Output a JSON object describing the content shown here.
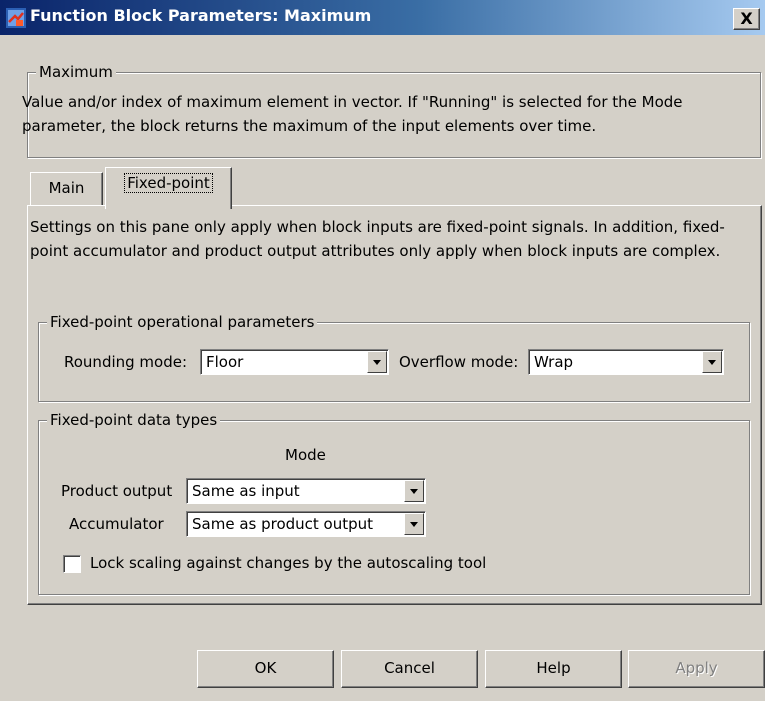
{
  "window": {
    "title": "Function Block Parameters: Maximum",
    "close_label": "X",
    "icon": "simulink-block-icon"
  },
  "block": {
    "name": "Maximum",
    "description": "Value and/or index of maximum element in vector. If \"Running\" is selected for the Mode parameter, the block returns the maximum of the input elements over time."
  },
  "tabs": [
    {
      "label": "Main",
      "selected": false
    },
    {
      "label": "Fixed-point",
      "selected": true
    }
  ],
  "fixed_point": {
    "info": "Settings on this pane only apply when block inputs are fixed-point signals. In addition, fixed-point accumulator and product output attributes only apply when block inputs are complex.",
    "operational": {
      "legend": "Fixed-point operational parameters",
      "rounding_label": "Rounding mode:",
      "rounding_value": "Floor",
      "overflow_label": "Overflow mode:",
      "overflow_value": "Wrap"
    },
    "data_types": {
      "legend": "Fixed-point data types",
      "mode_header": "Mode",
      "product_label": "Product output",
      "product_value": "Same as input",
      "accumulator_label": "Accumulator",
      "accumulator_value": "Same as product output",
      "lock_label": "Lock scaling against changes by the autoscaling tool",
      "lock_checked": false
    }
  },
  "buttons": {
    "ok": "OK",
    "cancel": "Cancel",
    "help": "Help",
    "apply": "Apply"
  }
}
